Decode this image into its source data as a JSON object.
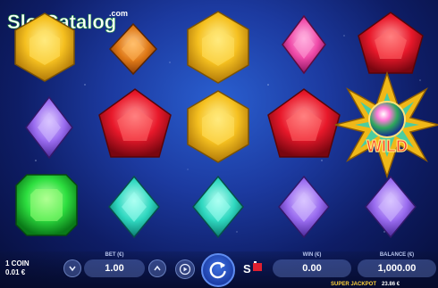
{
  "watermark": {
    "text": "SlotCatalog",
    "suffix": ".com"
  },
  "reels": {
    "rows": [
      [
        "yellow-gem",
        "orange-gem",
        "yellow-gem",
        "pink-gem",
        "red-gem"
      ],
      [
        "purple-gem",
        "red-gem",
        "yellow-gem",
        "red-gem",
        "wild-star"
      ],
      [
        "green-gem",
        "teal-gem",
        "teal-gem",
        "purple-gem",
        "purple-gem"
      ]
    ],
    "wild_label": "WILD"
  },
  "controls": {
    "coin_label": "1 COIN",
    "coin_value": "0.01 €",
    "bet_label": "BET (€)",
    "bet_value": "1.00",
    "win_label": "WIN (€)",
    "win_value": "0.00",
    "balance_label": "BALANCE (€)",
    "balance_value": "1,000.00",
    "super_jackpot_label": "SUPER JACKPOT",
    "super_jackpot_value": "23.86 €",
    "bet_down_icon": "chevron-down-icon",
    "bet_up_icon": "chevron-up-icon",
    "autoplay_icon": "autoplay-icon",
    "spin_icon": "spin-arrow-icon",
    "turbo_icon": "turbo-icon"
  },
  "colors": {
    "background": "#1c3aa0",
    "yellow": "#f5c020",
    "orange": "#e07a18",
    "pink": "#f04aa8",
    "red": "#e8182a",
    "purple": "#9a6cf0",
    "green": "#2ee040",
    "teal": "#2fd8c0"
  }
}
